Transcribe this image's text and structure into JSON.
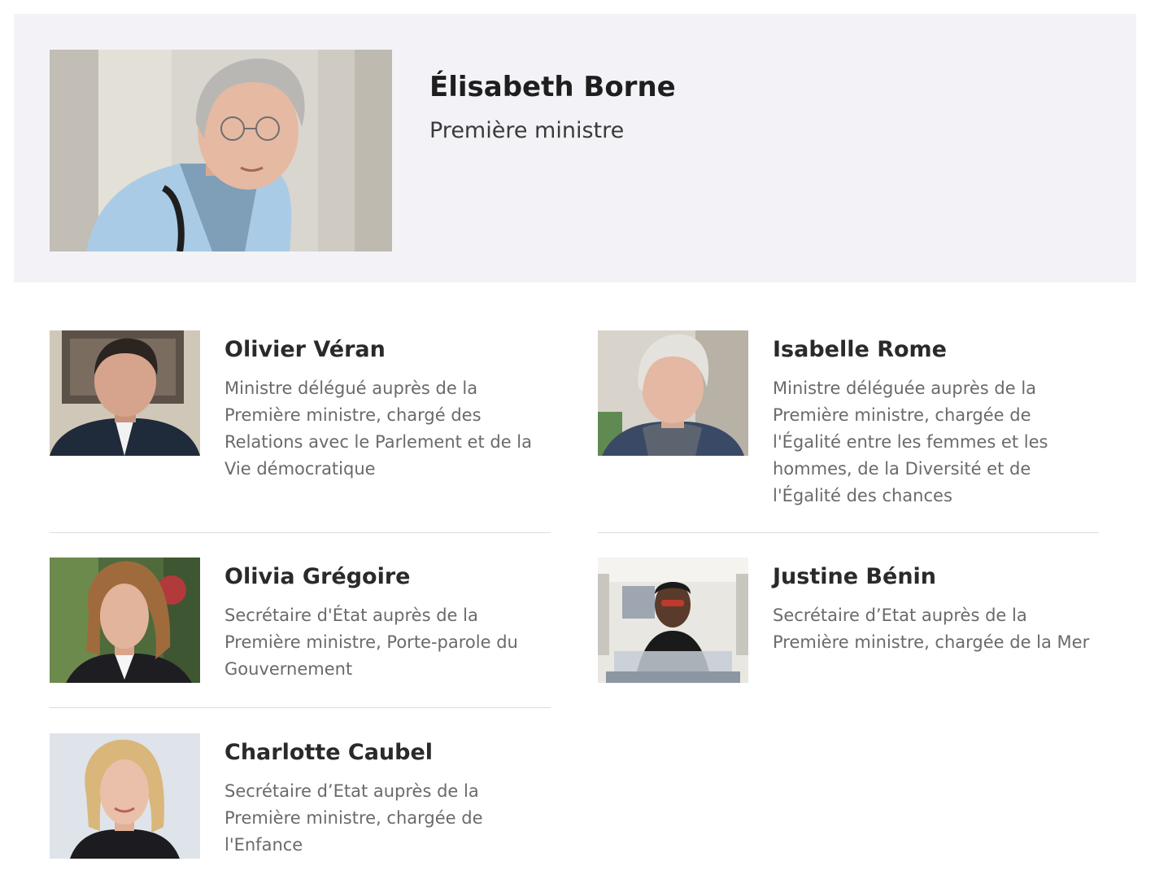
{
  "featured": {
    "name": "Élisabeth Borne",
    "role": "Première ministre"
  },
  "members": [
    {
      "name": "Olivier Véran",
      "role": "Ministre délégué auprès de la Première ministre, chargé des Relations avec le Parlement et de la Vie démocratique"
    },
    {
      "name": "Isabelle Rome",
      "role": "Ministre déléguée auprès de la Première ministre, chargée de l'Égalité entre les femmes et les hommes, de la Diversité et de l'Égalité des chances"
    },
    {
      "name": "Olivia Grégoire",
      "role": "Secrétaire d'État auprès de la Première ministre, Porte-parole du Gouvernement"
    },
    {
      "name": "Justine Bénin",
      "role": "Secrétaire d’Etat auprès de la Première ministre, chargée de la Mer"
    },
    {
      "name": "Charlotte Caubel",
      "role": "Secrétaire d’Etat auprès de la Première ministre, chargée de l'Enfance"
    }
  ]
}
